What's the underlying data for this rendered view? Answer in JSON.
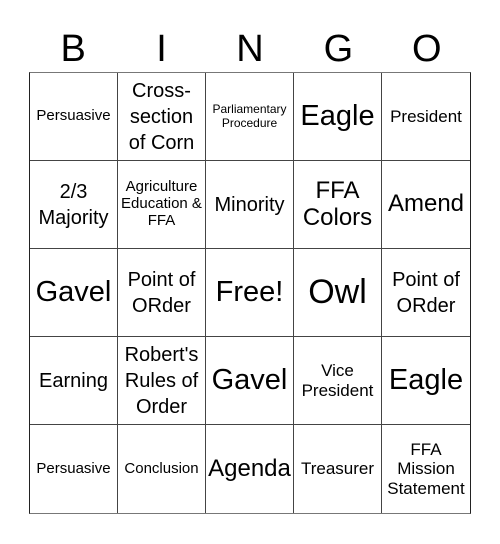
{
  "header": {
    "letters": [
      "B",
      "I",
      "N",
      "G",
      "O"
    ]
  },
  "board": {
    "rows": [
      [
        "Persuasive",
        "Cross-section of Corn",
        "Parliamentary Procedure",
        "Eagle",
        "President"
      ],
      [
        "2/3 Majority",
        "Agriculture Education & FFA",
        "Minority",
        "FFA Colors",
        "Amend"
      ],
      [
        "Gavel",
        "Point of ORder",
        "Free!",
        "Owl",
        "Point of ORder"
      ],
      [
        "Earning",
        "Robert's Rules of Order",
        "Gavel",
        "Vice President",
        "Eagle"
      ],
      [
        "Persuasive",
        "Conclusion",
        "Agenda",
        "Treasurer",
        "FFA Mission Statement"
      ]
    ],
    "free_space": "Free!"
  }
}
